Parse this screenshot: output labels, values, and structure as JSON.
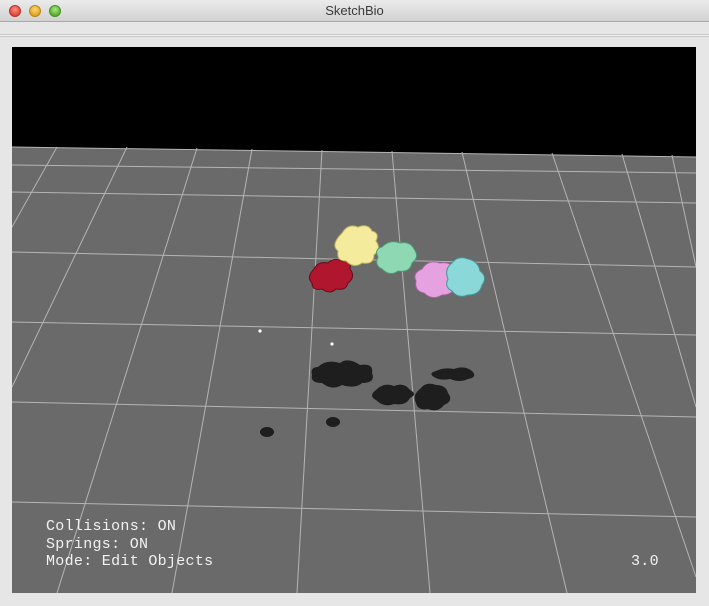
{
  "window": {
    "title": "SketchBio"
  },
  "hud": {
    "collisions": "Collisions: ON",
    "springs": "Springs: ON",
    "mode": "Mode: Edit Objects",
    "version": "3.0"
  },
  "scene": {
    "background_color": "#000000",
    "floor_color": "#6a6a6a",
    "grid_line_color": "#b4b4b4",
    "shadow_color": "#1e1e1e",
    "objects": [
      {
        "name": "yellow-molecule",
        "color": "#f4ec9c"
      },
      {
        "name": "green-molecule",
        "color": "#8fd8b4"
      },
      {
        "name": "red-molecule",
        "color": "#b0162e"
      },
      {
        "name": "pink-molecule",
        "color": "#e6a2e0"
      },
      {
        "name": "cyan-molecule",
        "color": "#8ad8d8"
      }
    ]
  }
}
